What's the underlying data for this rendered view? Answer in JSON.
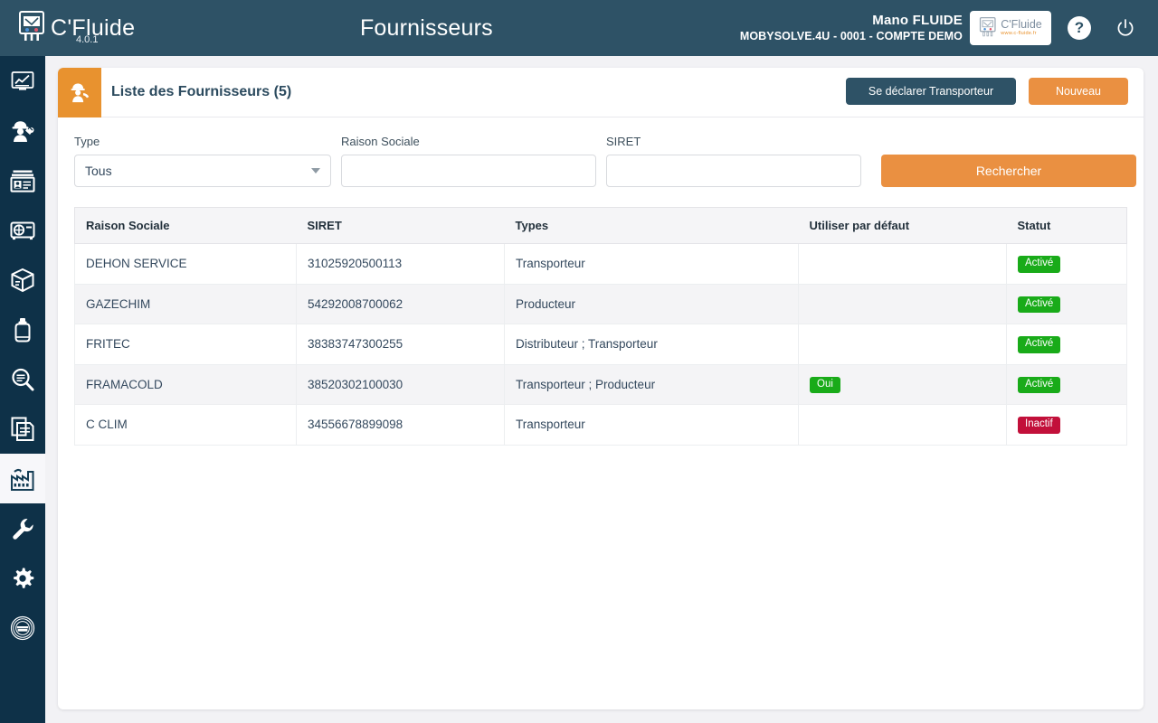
{
  "header": {
    "brand_name": "C'Fluide",
    "brand_version": "4.0.1",
    "page_title": "Fournisseurs",
    "account_name": "Mano FLUIDE",
    "account_sub": "MOBYSOLVE.4U - 0001 - COMPTE DEMO",
    "logo_badge_name": "C'Fluide",
    "logo_badge_url": "www.c-fluide.fr",
    "help_label": "?",
    "help_icon": "question-mark-icon",
    "power_icon": "power-icon"
  },
  "sidebar": {
    "items": [
      {
        "icon": "chart-dashboard-icon",
        "active": false
      },
      {
        "icon": "technician-worker-icon",
        "active": false
      },
      {
        "icon": "company-card-icon",
        "active": false
      },
      {
        "icon": "equipment-meter-icon",
        "active": false
      },
      {
        "icon": "package-box-icon",
        "active": false
      },
      {
        "icon": "gas-cylinder-icon",
        "active": false
      },
      {
        "icon": "search-document-icon",
        "active": false
      },
      {
        "icon": "documents-icon",
        "active": false
      },
      {
        "icon": "factory-icon",
        "active": true
      },
      {
        "icon": "wrench-icon",
        "active": false
      },
      {
        "icon": "gear-icon",
        "active": false
      },
      {
        "icon": "track-seal-icon",
        "active": false
      }
    ]
  },
  "card": {
    "title": "Liste des Fournisseurs (5)",
    "header_icon": "worker-hardhat-icon",
    "declare_button": "Se déclarer Transporteur",
    "new_button": "Nouveau"
  },
  "filters": {
    "type_label": "Type",
    "type_value": "Tous",
    "raison_label": "Raison Sociale",
    "raison_value": "",
    "raison_placeholder": "",
    "siret_label": "SIRET",
    "siret_value": "",
    "siret_placeholder": "",
    "search_button": "Rechercher"
  },
  "table": {
    "columns": [
      "Raison Sociale",
      "SIRET",
      "Types",
      "Utiliser par défaut",
      "Statut"
    ],
    "rows": [
      {
        "raison_sociale": "DEHON SERVICE",
        "siret": "31025920500113",
        "types": "Transporteur",
        "defaut": "",
        "statut": "Activé",
        "statut_state": "green"
      },
      {
        "raison_sociale": "GAZECHIM",
        "siret": "54292008700062",
        "types": "Producteur",
        "defaut": "",
        "statut": "Activé",
        "statut_state": "green"
      },
      {
        "raison_sociale": "FRITEC",
        "siret": "38383747300255",
        "types": "Distributeur ; Transporteur",
        "defaut": "",
        "statut": "Activé",
        "statut_state": "green"
      },
      {
        "raison_sociale": "FRAMACOLD",
        "siret": "38520302100030",
        "types": "Transporteur ; Producteur",
        "defaut": "Oui",
        "statut": "Activé",
        "statut_state": "green"
      },
      {
        "raison_sociale": "C CLIM",
        "siret": "34556678899098",
        "types": "Transporteur",
        "defaut": "",
        "statut": "Inactif",
        "statut_state": "red"
      }
    ]
  },
  "colors": {
    "header_bg": "#2e5266",
    "sidebar_bg": "#0e3148",
    "accent_orange": "#ea9041",
    "badge_green": "#19ab19",
    "badge_red": "#c2103a"
  }
}
